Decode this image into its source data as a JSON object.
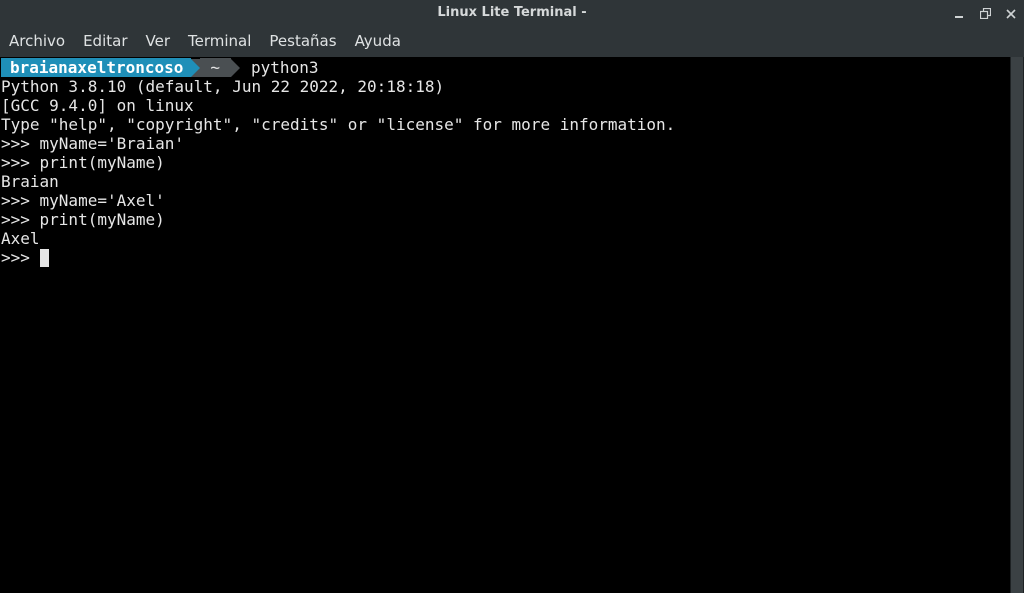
{
  "window": {
    "title": "Linux Lite Terminal -"
  },
  "menu": {
    "items": [
      "Archivo",
      "Editar",
      "Ver",
      "Terminal",
      "Pestañas",
      "Ayuda"
    ]
  },
  "prompt": {
    "user": "braianaxeltroncoso",
    "dir": "~",
    "command": "python3"
  },
  "terminal": {
    "lines": [
      "Python 3.8.10 (default, Jun 22 2022, 20:18:18)",
      "[GCC 9.4.0] on linux",
      "Type \"help\", \"copyright\", \"credits\" or \"license\" for more information.",
      ">>> myName='Braian'",
      ">>> print(myName)",
      "Braian",
      ">>> myName='Axel'",
      ">>> print(myName)",
      "Axel"
    ],
    "current_prompt": ">>>"
  },
  "colors": {
    "user_segment": "#1f8fb8",
    "dir_segment": "#4a4f52",
    "chrome": "#2f3538",
    "background": "#000000"
  }
}
